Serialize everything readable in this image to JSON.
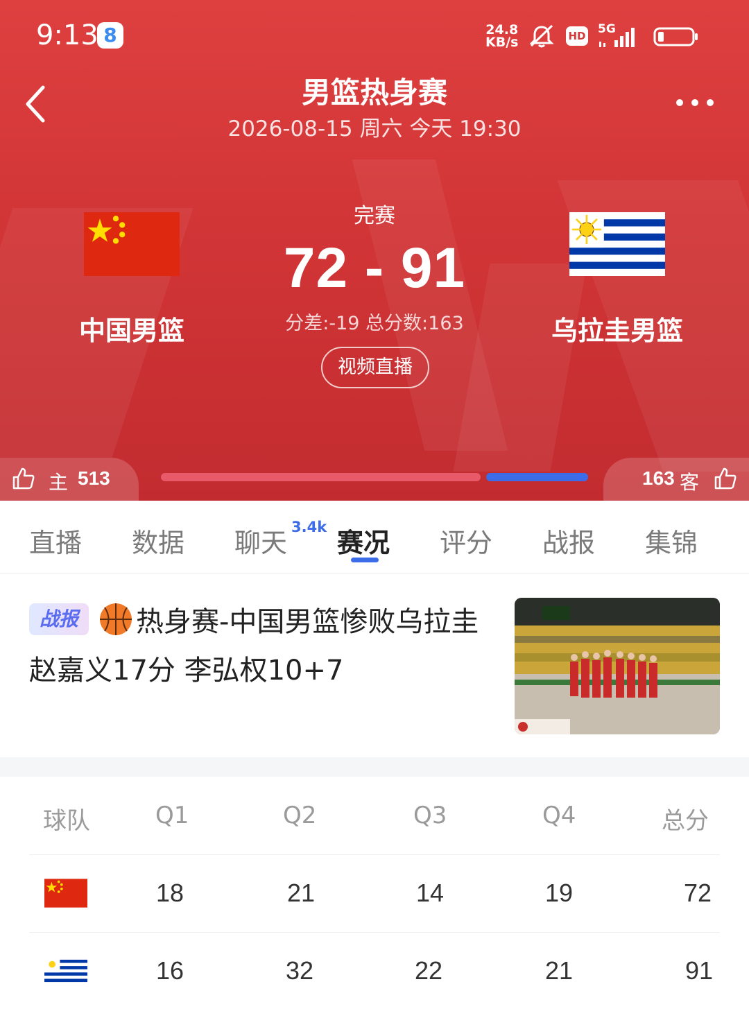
{
  "status_bar": {
    "time": "9:13",
    "badge": "8",
    "net_speed_value": "24.8",
    "net_speed_unit": "KB/s",
    "hd_label": "HD",
    "signal_label": "5G",
    "icons": [
      "mute-bell-icon",
      "hd-icon",
      "signal-icon",
      "battery-icon"
    ]
  },
  "header": {
    "title": "男篮热身赛",
    "subtitle": "2026-08-15 周六 今天 19:30",
    "back_icon": "chevron-left-icon",
    "more_icon": "more-dots-icon"
  },
  "match": {
    "status": "完赛",
    "score": "72 - 91",
    "meta": "分差:-19 总分数:163",
    "video_button": "视频直播",
    "home": {
      "name": "中国男篮",
      "flag": "china-flag"
    },
    "away": {
      "name": "乌拉圭男篮",
      "flag": "uruguay-flag"
    }
  },
  "vote": {
    "home_label": "主",
    "home_count": "513",
    "away_label": "客",
    "away_count": "163",
    "home_share": 0.759
  },
  "tabs": {
    "items": [
      {
        "label": "直播"
      },
      {
        "label": "数据"
      },
      {
        "label": "聊天"
      },
      {
        "label": "赛况"
      },
      {
        "label": "评分"
      },
      {
        "label": "战报"
      },
      {
        "label": "集锦"
      }
    ],
    "chat_badge": "3.4k",
    "active": "赛况"
  },
  "news": {
    "tag": "战报",
    "title": "热身赛-中国男篮惨败乌拉圭 赵嘉义17分 李弘权10+7"
  },
  "score_table": {
    "headers": [
      "球队",
      "Q1",
      "Q2",
      "Q3",
      "Q4",
      "总分"
    ],
    "rows": [
      {
        "team_flag": "china-flag",
        "q1": "18",
        "q2": "21",
        "q3": "14",
        "q4": "19",
        "total": "72"
      },
      {
        "team_flag": "uruguay-flag",
        "q1": "16",
        "q2": "32",
        "q3": "22",
        "q4": "21",
        "total": "91"
      }
    ]
  },
  "colors": {
    "header_red": "#d23536",
    "accent_blue": "#3d6ce8",
    "home_bar": "#e85a6a"
  }
}
